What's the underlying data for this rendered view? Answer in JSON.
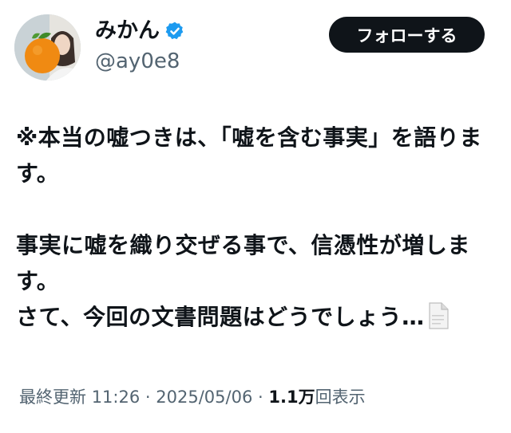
{
  "user": {
    "display_name": "みかん",
    "handle": "@ay0e8",
    "verified": true,
    "avatar": "orange-and-person-avatar"
  },
  "follow_button": {
    "label": "フォローする"
  },
  "post": {
    "lines": [
      "※本当の嘘つきは、「嘘を含む事実」を語ります。",
      "",
      "事実に嘘を織り交ぜる事で、信憑性が増します。",
      "さて、今回の文書問題はどうでしょう…"
    ],
    "trailing_icon": "page-facing-up-icon"
  },
  "meta": {
    "updated_label": "最終更新",
    "time": "11:26",
    "separator": "·",
    "date": "2025/05/06",
    "views_count": "1.1万",
    "views_label": "回表示"
  },
  "colors": {
    "text": "#0f1419",
    "muted": "#536471",
    "verified": "#1d9bf0",
    "button_bg": "#0f1419",
    "button_text": "#ffffff"
  }
}
